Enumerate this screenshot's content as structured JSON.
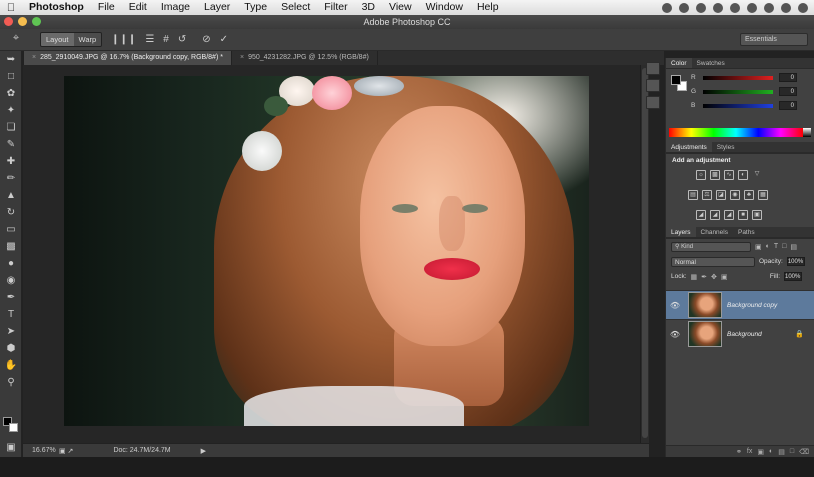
{
  "menubar": {
    "items": [
      "Photoshop",
      "File",
      "Edit",
      "Image",
      "Layer",
      "Type",
      "Select",
      "Filter",
      "3D",
      "View",
      "Window",
      "Help"
    ],
    "tray_icons": [
      "sync-icon",
      "network-icon",
      "wifi-icon",
      "paw-icon",
      "chat-icon",
      "moon-icon",
      "bluetooth-icon",
      "volume-icon",
      "battery-icon"
    ]
  },
  "window": {
    "title": "Adobe Photoshop CC"
  },
  "options": {
    "layout_label": "Layout",
    "warp_label": "Warp",
    "workspace": "Essentials"
  },
  "tabs": [
    {
      "label": "285_2910049.JPG @ 16.7% (Background copy, RGB/8#) *",
      "active": true
    },
    {
      "label": "950_4231282.JPG @ 12.5% (RGB/8#)",
      "active": false
    }
  ],
  "status": {
    "zoom": "16.67%",
    "doc": "Doc: 24.7M/24.7M"
  },
  "color_panel": {
    "tabs": [
      "Color",
      "Swatches"
    ],
    "channels": [
      {
        "label": "R",
        "value": "0",
        "color": "#e02020"
      },
      {
        "label": "G",
        "value": "0",
        "color": "#20b020"
      },
      {
        "label": "B",
        "value": "0",
        "color": "#2040e0"
      }
    ]
  },
  "adjustments_panel": {
    "tabs": [
      "Adjustments",
      "Styles"
    ],
    "title": "Add an adjustment"
  },
  "layers_panel": {
    "tabs": [
      "Layers",
      "Channels",
      "Paths"
    ],
    "filter": "Kind",
    "blend_mode": "Normal",
    "opacity_label": "Opacity:",
    "opacity": "100%",
    "lock_label": "Lock:",
    "fill_label": "Fill:",
    "fill": "100%",
    "layers": [
      {
        "name": "Background copy",
        "selected": true
      },
      {
        "name": "Background",
        "selected": false
      }
    ]
  }
}
